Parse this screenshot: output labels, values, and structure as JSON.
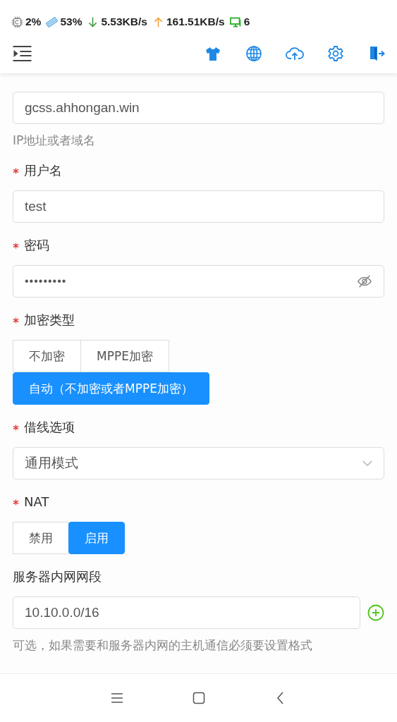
{
  "status_bar": {
    "cpu": "2%",
    "memory": "53%",
    "download": "5.53KB/s",
    "upload": "161.51KB/s",
    "clients": "6"
  },
  "form": {
    "fields": [
      {
        "kind": "text",
        "value": "gcss.ahhongan.win",
        "hint": "IP地址或者域名"
      },
      {
        "kind": "text",
        "label": "用户名",
        "required": true,
        "value": "test"
      },
      {
        "kind": "password",
        "label": "密码",
        "required": true,
        "value": "•••••••••"
      },
      {
        "kind": "radio",
        "label": "加密类型",
        "required": true,
        "options": [
          {
            "label": "不加密",
            "selected": false
          },
          {
            "label": "MPPE加密",
            "selected": false
          },
          {
            "label": "自动（不加密或者MPPE加密）",
            "selected": true
          }
        ]
      },
      {
        "kind": "select",
        "label": "借线选项",
        "required": true,
        "value": "通用模式"
      },
      {
        "kind": "radio",
        "label": "NAT",
        "required": true,
        "options": [
          {
            "label": "禁用",
            "selected": false
          },
          {
            "label": "启用",
            "selected": true
          }
        ]
      },
      {
        "kind": "text_add",
        "label": "服务器内网网段",
        "required": false,
        "value": "10.10.0.0/16",
        "hint": "可选，如果需要和服务器内网的主机通信必须要设置格式"
      }
    ]
  }
}
